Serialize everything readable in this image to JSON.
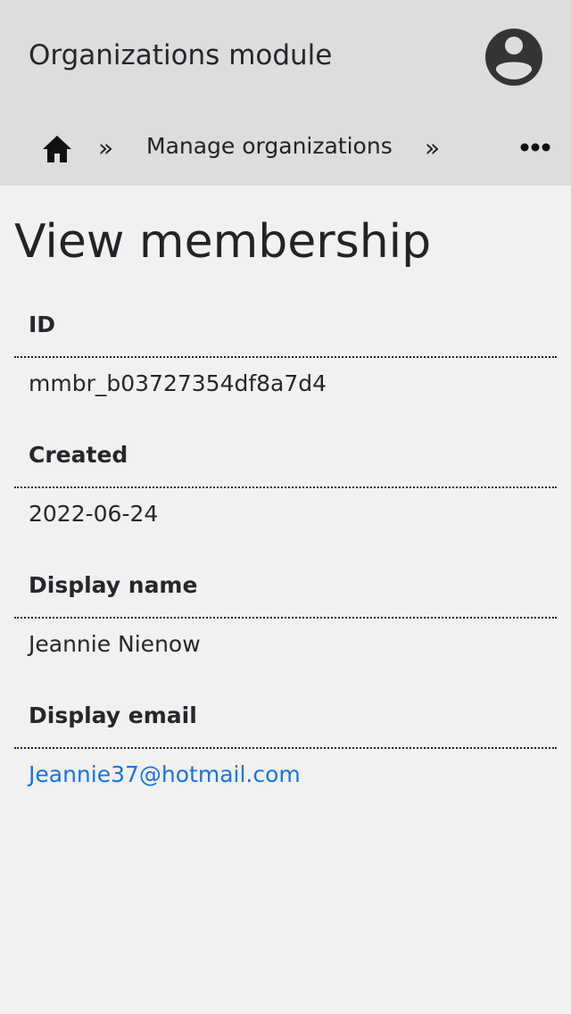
{
  "header": {
    "app_title": "Organizations module",
    "avatar_icon": "account-circle-icon"
  },
  "breadcrumb": {
    "home_icon": "home-icon",
    "separator": "»",
    "items": [
      {
        "label": "Manage organizations"
      }
    ],
    "more_icon": "more-horizontal-icon"
  },
  "main": {
    "title": "View membership",
    "fields": [
      {
        "label": "ID",
        "value": "mmbr_b03727354df8a7d4"
      },
      {
        "label": "Created",
        "value": "2022-06-24"
      },
      {
        "label": "Display name",
        "value": "Jeannie Nienow"
      },
      {
        "label": "Display email",
        "value": "Jeannie37@hotmail.com"
      }
    ]
  },
  "colors": {
    "header_bg": "#dddddd",
    "page_bg": "#f1f1f1",
    "text": "#222326",
    "link": "#1a73e8"
  }
}
